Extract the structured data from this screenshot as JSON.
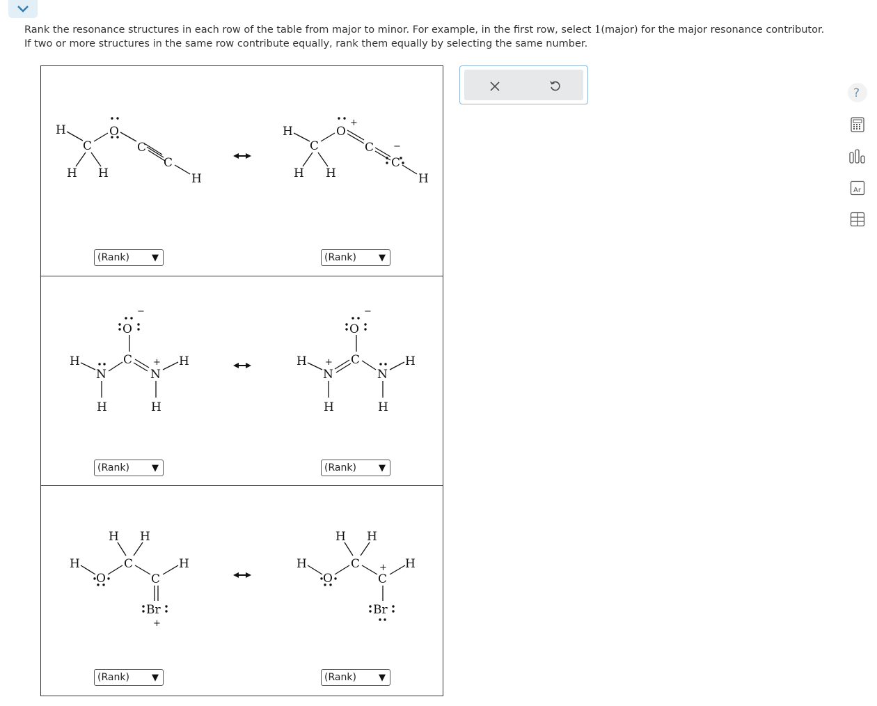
{
  "nav": {
    "collapse_icon": "chevron-down-icon"
  },
  "instructions": {
    "part1": "Rank the resonance structures in each row of the table from major to minor. For example, in the first row, select ",
    "one": "1",
    "part2": "(major) for the major resonance contributor. If two or more structures in the same row contribute equally, rank them equally by selecting the same number."
  },
  "table": {
    "rows": [
      {
        "left_rank": "(Rank)",
        "right_rank": "(Rank)"
      },
      {
        "left_rank": "(Rank)",
        "right_rank": "(Rank)"
      },
      {
        "left_rank": "(Rank)",
        "right_rank": "(Rank)"
      }
    ]
  },
  "molecules": {
    "H": "H",
    "C": "C",
    "O": "O",
    "N": "N",
    "Br": "Br",
    "plus": "+",
    "minus": "−",
    "arrow": "↔"
  },
  "actions": {
    "clear_icon": "close-icon",
    "reset_icon": "undo-icon"
  },
  "tools": [
    "help-icon",
    "calculator-icon",
    "chart-icon",
    "periodic-table-icon",
    "data-table-icon"
  ],
  "colors": {
    "accent": "#2f7ab0",
    "tool_blue": "#5e88a8"
  }
}
